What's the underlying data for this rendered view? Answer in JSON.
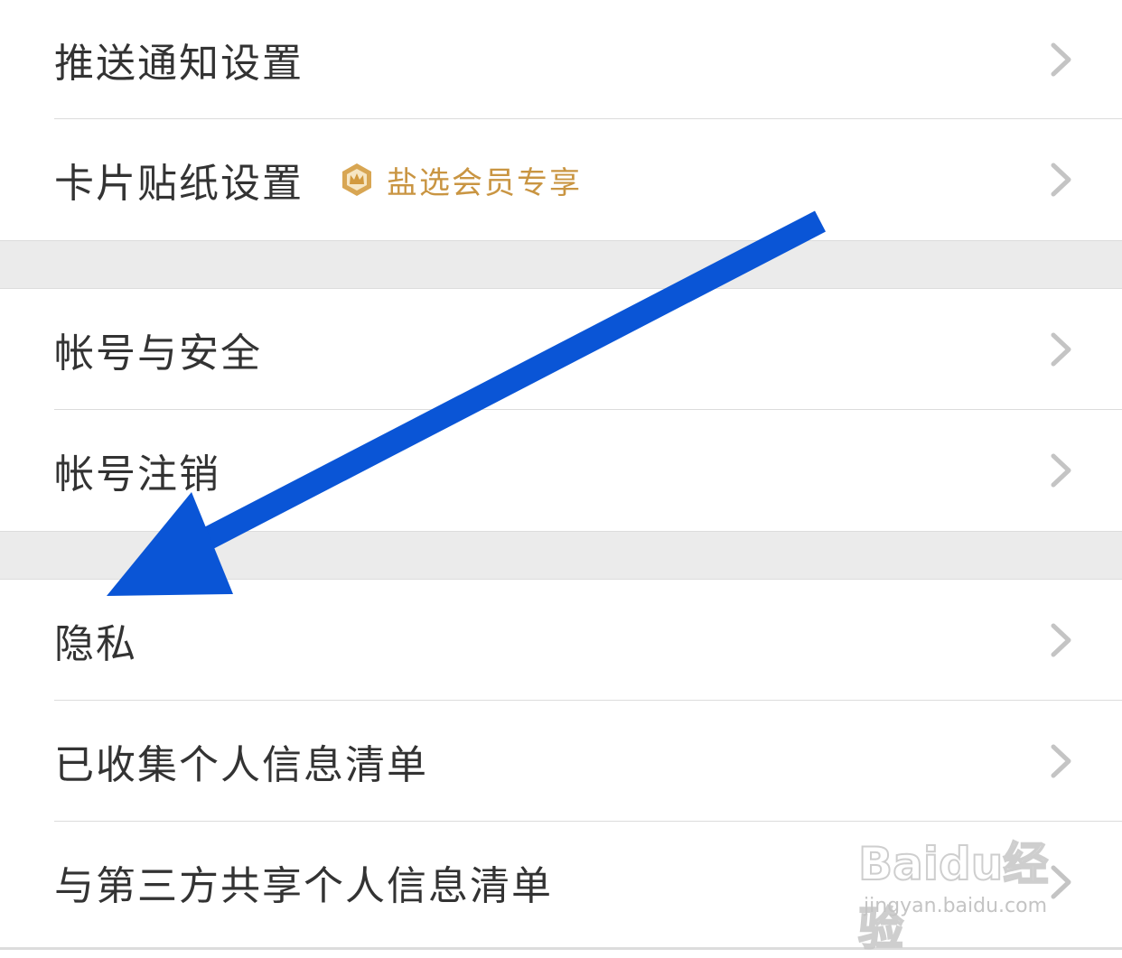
{
  "items": [
    {
      "label": "推送通知设置"
    },
    {
      "label": "卡片贴纸设置",
      "badge": "盐选会员专享"
    },
    {
      "label": "帐号与安全"
    },
    {
      "label": "帐号注销"
    },
    {
      "label": "隐私"
    },
    {
      "label": "已收集个人信息清单"
    },
    {
      "label": "与第三方共享个人信息清单"
    }
  ],
  "colors": {
    "text": "#333333",
    "badge": "#c99542",
    "chevron": "#c4c4c4",
    "gap": "#ebebeb",
    "arrow": "#0a55d6"
  },
  "watermark": {
    "logo": "Baidu经验",
    "url": "jingyan.baidu.com"
  }
}
